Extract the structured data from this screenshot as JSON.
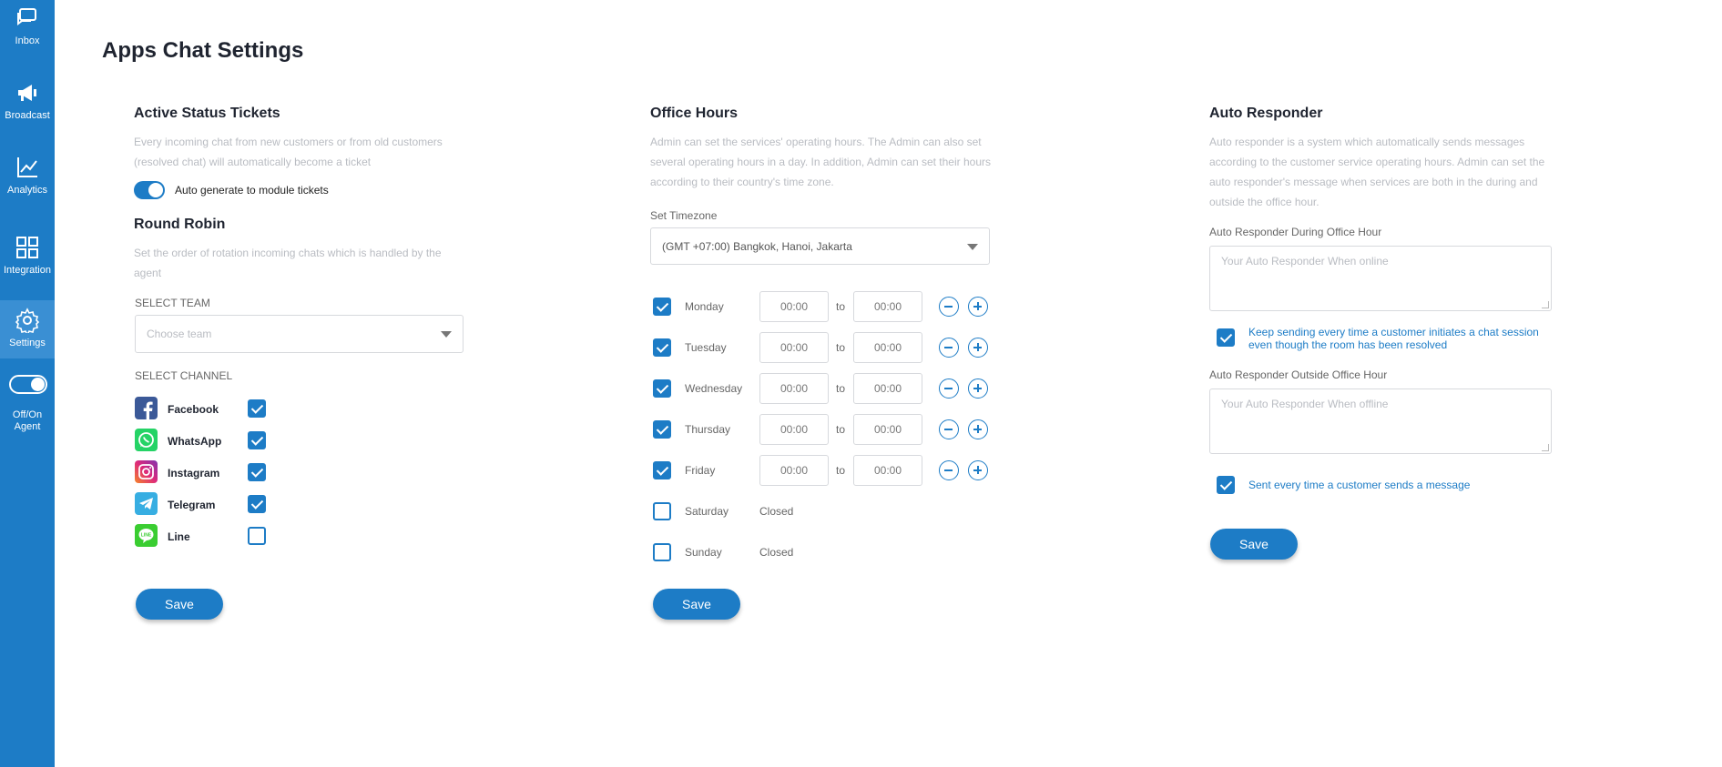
{
  "sidebar": {
    "items": [
      {
        "label": "Inbox",
        "icon": "chat-icon"
      },
      {
        "label": "Broadcast",
        "icon": "megaphone-icon"
      },
      {
        "label": "Analytics",
        "icon": "chart-icon"
      },
      {
        "label": "Integration",
        "icon": "grid-icon"
      },
      {
        "label": "Settings",
        "icon": "gear-icon"
      }
    ],
    "agent_toggle_label": "Off/On Agent"
  },
  "page": {
    "title": "Apps Chat Settings"
  },
  "active_status": {
    "title": "Active Status Tickets",
    "description": "Every incoming chat from new customers or from old customers (resolved chat) will automatically become a ticket",
    "toggle_label": "Auto generate to module tickets"
  },
  "round_robin": {
    "title": "Round Robin",
    "description": "Set the order of rotation incoming chats which is handled by the agent",
    "select_team_label": "SELECT TEAM",
    "team_placeholder": "Choose team",
    "select_channel_label": "SELECT CHANNEL",
    "channels": [
      {
        "name": "Facebook",
        "checked": true,
        "color": "#3b5998"
      },
      {
        "name": "WhatsApp",
        "checked": true,
        "color": "#25d366"
      },
      {
        "name": "Instagram",
        "checked": true,
        "color": "#c13584"
      },
      {
        "name": "Telegram",
        "checked": true,
        "color": "#37aee2"
      },
      {
        "name": "Line",
        "checked": false,
        "color": "#3acd31"
      }
    ],
    "save_label": "Save"
  },
  "office_hours": {
    "title": "Office Hours",
    "description": "Admin can set the services' operating hours. The Admin can also set several operating hours in a day. In addition, Admin can set their hours according to their country's time zone.",
    "timezone_label": "Set Timezone",
    "timezone_value": "(GMT +07:00) Bangkok, Hanoi, Jakarta",
    "days": [
      {
        "name": "Monday",
        "checked": true,
        "from": "00:00",
        "to": "00:00"
      },
      {
        "name": "Tuesday",
        "checked": true,
        "from": "00:00",
        "to": "00:00"
      },
      {
        "name": "Wednesday",
        "checked": true,
        "from": "00:00",
        "to": "00:00"
      },
      {
        "name": "Thursday",
        "checked": true,
        "from": "00:00",
        "to": "00:00"
      },
      {
        "name": "Friday",
        "checked": true,
        "from": "00:00",
        "to": "00:00"
      },
      {
        "name": "Saturday",
        "checked": false,
        "status": "Closed"
      },
      {
        "name": "Sunday",
        "checked": false,
        "status": "Closed"
      }
    ],
    "to_text": "to",
    "save_label": "Save"
  },
  "auto_responder": {
    "title": "Auto Responder",
    "description": "Auto responder is a system which automatically sends messages according to the customer service operating hours. Admin can set the auto responder's message when services are both in the during and outside the office hour.",
    "during_label": "Auto Responder During Office Hour",
    "during_placeholder": "Your Auto Responder When online",
    "keep_sending_text": "Keep sending every time a customer initiates a chat session even though the room has been resolved",
    "outside_label": "Auto Responder Outside Office Hour",
    "outside_placeholder": "Your Auto Responder When offline",
    "sent_every_text": "Sent every time a customer sends a message",
    "save_label": "Save"
  },
  "colors": {
    "primary": "#1d7cc6",
    "sidebar": "#1d7cc6",
    "muted_text": "#b9bcc2"
  }
}
